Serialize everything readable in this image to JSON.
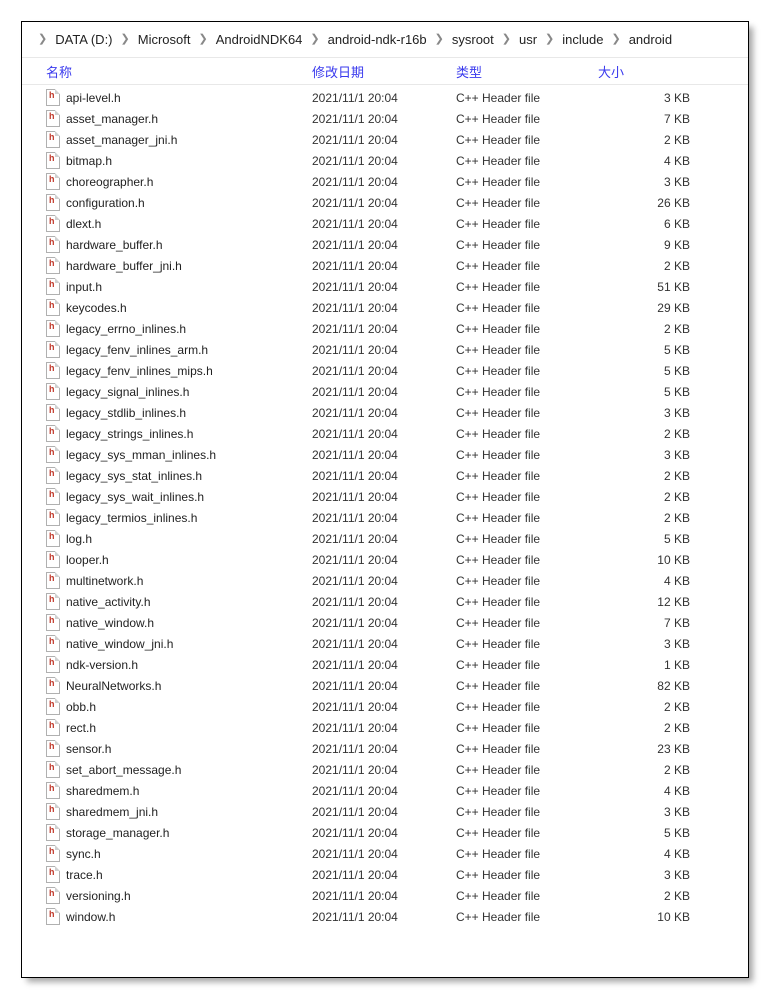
{
  "breadcrumb": [
    "DATA (D:)",
    "Microsoft",
    "AndroidNDK64",
    "android-ndk-r16b",
    "sysroot",
    "usr",
    "include",
    "android"
  ],
  "columns": {
    "name": "名称",
    "date": "修改日期",
    "type": "类型",
    "size": "大小"
  },
  "files": [
    {
      "name": "api-level.h",
      "date": "2021/11/1 20:04",
      "type": "C++ Header file",
      "size": "3 KB"
    },
    {
      "name": "asset_manager.h",
      "date": "2021/11/1 20:04",
      "type": "C++ Header file",
      "size": "7 KB"
    },
    {
      "name": "asset_manager_jni.h",
      "date": "2021/11/1 20:04",
      "type": "C++ Header file",
      "size": "2 KB"
    },
    {
      "name": "bitmap.h",
      "date": "2021/11/1 20:04",
      "type": "C++ Header file",
      "size": "4 KB"
    },
    {
      "name": "choreographer.h",
      "date": "2021/11/1 20:04",
      "type": "C++ Header file",
      "size": "3 KB"
    },
    {
      "name": "configuration.h",
      "date": "2021/11/1 20:04",
      "type": "C++ Header file",
      "size": "26 KB"
    },
    {
      "name": "dlext.h",
      "date": "2021/11/1 20:04",
      "type": "C++ Header file",
      "size": "6 KB"
    },
    {
      "name": "hardware_buffer.h",
      "date": "2021/11/1 20:04",
      "type": "C++ Header file",
      "size": "9 KB"
    },
    {
      "name": "hardware_buffer_jni.h",
      "date": "2021/11/1 20:04",
      "type": "C++ Header file",
      "size": "2 KB"
    },
    {
      "name": "input.h",
      "date": "2021/11/1 20:04",
      "type": "C++ Header file",
      "size": "51 KB"
    },
    {
      "name": "keycodes.h",
      "date": "2021/11/1 20:04",
      "type": "C++ Header file",
      "size": "29 KB"
    },
    {
      "name": "legacy_errno_inlines.h",
      "date": "2021/11/1 20:04",
      "type": "C++ Header file",
      "size": "2 KB"
    },
    {
      "name": "legacy_fenv_inlines_arm.h",
      "date": "2021/11/1 20:04",
      "type": "C++ Header file",
      "size": "5 KB"
    },
    {
      "name": "legacy_fenv_inlines_mips.h",
      "date": "2021/11/1 20:04",
      "type": "C++ Header file",
      "size": "5 KB"
    },
    {
      "name": "legacy_signal_inlines.h",
      "date": "2021/11/1 20:04",
      "type": "C++ Header file",
      "size": "5 KB"
    },
    {
      "name": "legacy_stdlib_inlines.h",
      "date": "2021/11/1 20:04",
      "type": "C++ Header file",
      "size": "3 KB"
    },
    {
      "name": "legacy_strings_inlines.h",
      "date": "2021/11/1 20:04",
      "type": "C++ Header file",
      "size": "2 KB"
    },
    {
      "name": "legacy_sys_mman_inlines.h",
      "date": "2021/11/1 20:04",
      "type": "C++ Header file",
      "size": "3 KB"
    },
    {
      "name": "legacy_sys_stat_inlines.h",
      "date": "2021/11/1 20:04",
      "type": "C++ Header file",
      "size": "2 KB"
    },
    {
      "name": "legacy_sys_wait_inlines.h",
      "date": "2021/11/1 20:04",
      "type": "C++ Header file",
      "size": "2 KB"
    },
    {
      "name": "legacy_termios_inlines.h",
      "date": "2021/11/1 20:04",
      "type": "C++ Header file",
      "size": "2 KB"
    },
    {
      "name": "log.h",
      "date": "2021/11/1 20:04",
      "type": "C++ Header file",
      "size": "5 KB"
    },
    {
      "name": "looper.h",
      "date": "2021/11/1 20:04",
      "type": "C++ Header file",
      "size": "10 KB"
    },
    {
      "name": "multinetwork.h",
      "date": "2021/11/1 20:04",
      "type": "C++ Header file",
      "size": "4 KB"
    },
    {
      "name": "native_activity.h",
      "date": "2021/11/1 20:04",
      "type": "C++ Header file",
      "size": "12 KB"
    },
    {
      "name": "native_window.h",
      "date": "2021/11/1 20:04",
      "type": "C++ Header file",
      "size": "7 KB"
    },
    {
      "name": "native_window_jni.h",
      "date": "2021/11/1 20:04",
      "type": "C++ Header file",
      "size": "3 KB"
    },
    {
      "name": "ndk-version.h",
      "date": "2021/11/1 20:04",
      "type": "C++ Header file",
      "size": "1 KB"
    },
    {
      "name": "NeuralNetworks.h",
      "date": "2021/11/1 20:04",
      "type": "C++ Header file",
      "size": "82 KB"
    },
    {
      "name": "obb.h",
      "date": "2021/11/1 20:04",
      "type": "C++ Header file",
      "size": "2 KB"
    },
    {
      "name": "rect.h",
      "date": "2021/11/1 20:04",
      "type": "C++ Header file",
      "size": "2 KB"
    },
    {
      "name": "sensor.h",
      "date": "2021/11/1 20:04",
      "type": "C++ Header file",
      "size": "23 KB"
    },
    {
      "name": "set_abort_message.h",
      "date": "2021/11/1 20:04",
      "type": "C++ Header file",
      "size": "2 KB"
    },
    {
      "name": "sharedmem.h",
      "date": "2021/11/1 20:04",
      "type": "C++ Header file",
      "size": "4 KB"
    },
    {
      "name": "sharedmem_jni.h",
      "date": "2021/11/1 20:04",
      "type": "C++ Header file",
      "size": "3 KB"
    },
    {
      "name": "storage_manager.h",
      "date": "2021/11/1 20:04",
      "type": "C++ Header file",
      "size": "5 KB"
    },
    {
      "name": "sync.h",
      "date": "2021/11/1 20:04",
      "type": "C++ Header file",
      "size": "4 KB"
    },
    {
      "name": "trace.h",
      "date": "2021/11/1 20:04",
      "type": "C++ Header file",
      "size": "3 KB"
    },
    {
      "name": "versioning.h",
      "date": "2021/11/1 20:04",
      "type": "C++ Header file",
      "size": "2 KB"
    },
    {
      "name": "window.h",
      "date": "2021/11/1 20:04",
      "type": "C++ Header file",
      "size": "10 KB"
    }
  ]
}
